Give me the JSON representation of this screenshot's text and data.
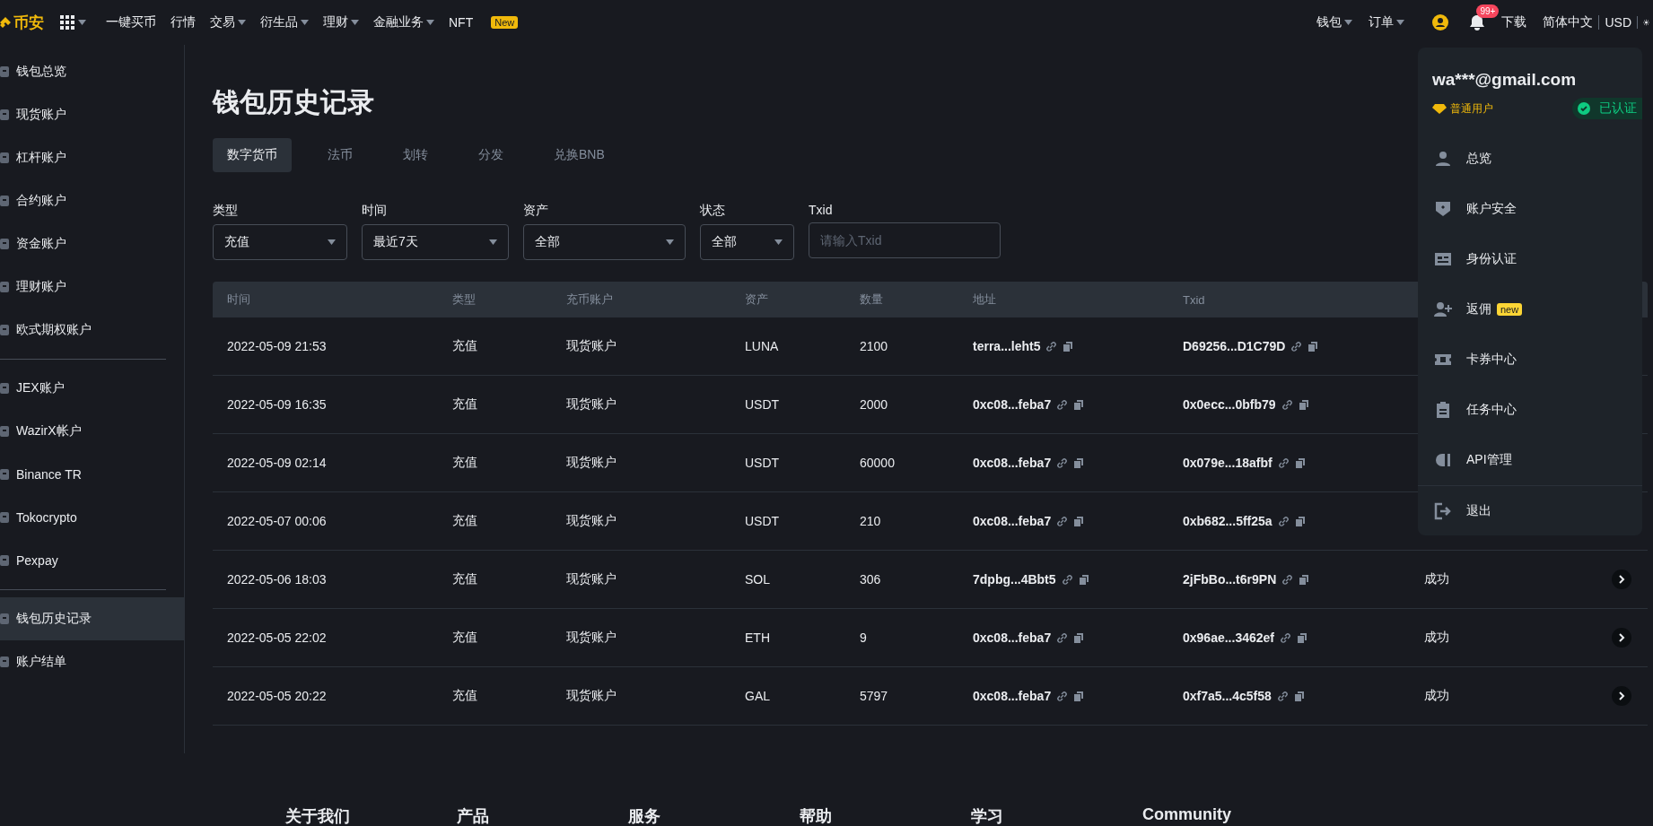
{
  "nav": {
    "logo": "币安",
    "items": [
      {
        "label": "一键买币",
        "dropdown": false
      },
      {
        "label": "行情",
        "dropdown": false
      },
      {
        "label": "交易",
        "dropdown": true
      },
      {
        "label": "衍生品",
        "dropdown": true
      },
      {
        "label": "理财",
        "dropdown": true
      },
      {
        "label": "金融业务",
        "dropdown": true
      },
      {
        "label": "NFT",
        "dropdown": false,
        "badge": "New"
      }
    ],
    "right": [
      {
        "kind": "menu",
        "label": "钱包"
      },
      {
        "kind": "menu",
        "label": "订单"
      },
      {
        "kind": "avatar"
      },
      {
        "kind": "bell",
        "badge": "99+"
      },
      {
        "kind": "link",
        "label": "下载",
        "separated": false
      },
      {
        "kind": "link",
        "label": "简体中文",
        "separated": false
      },
      {
        "kind": "link",
        "label": "USD",
        "separated": true
      },
      {
        "kind": "theme",
        "separated": true
      }
    ]
  },
  "sidebar": {
    "groups": [
      {
        "items": [
          {
            "label": "钱包总览",
            "selected": false
          },
          {
            "label": "现货账户",
            "selected": false
          },
          {
            "label": "杠杆账户",
            "selected": false
          },
          {
            "label": "合约账户",
            "selected": false
          },
          {
            "label": "资金账户",
            "selected": false
          },
          {
            "label": "理财账户",
            "selected": false
          },
          {
            "label": "欧式期权账户",
            "selected": false
          }
        ]
      },
      {
        "items": [
          {
            "label": "JEX账户",
            "selected": false
          },
          {
            "label": "WazirX帐户",
            "selected": false
          },
          {
            "label": "Binance TR",
            "selected": false
          },
          {
            "label": "Tokocrypto",
            "selected": false
          },
          {
            "label": "Pexpay",
            "selected": false
          }
        ]
      },
      {
        "items": [
          {
            "label": "钱包历史记录",
            "selected": true
          },
          {
            "label": "账户结单",
            "selected": false
          }
        ]
      }
    ]
  },
  "page": {
    "title": "钱包历史记录",
    "tabs": [
      {
        "label": "数字货币",
        "selected": true
      },
      {
        "label": "法币",
        "selected": false
      },
      {
        "label": "划转",
        "selected": false
      },
      {
        "label": "分发",
        "selected": false
      },
      {
        "label": "兑换BNB",
        "selected": false
      }
    ],
    "filters": [
      {
        "kind": "select",
        "label": "类型",
        "value": "充值"
      },
      {
        "kind": "select",
        "label": "时间",
        "value": "最近7天"
      },
      {
        "kind": "select",
        "label": "资产",
        "value": "全部"
      },
      {
        "kind": "select",
        "label": "状态",
        "value": "全部"
      },
      {
        "kind": "input",
        "label": "Txid",
        "placeholder": "请输入Txid"
      }
    ],
    "table": {
      "columns": [
        "时间",
        "类型",
        "充币账户",
        "资产",
        "数量",
        "地址",
        "Txid"
      ],
      "rows": [
        {
          "time": "2022-05-09 21:53",
          "type": "充值",
          "account": "现货账户",
          "asset": "LUNA",
          "amount": "2100",
          "address": "terra...leht5",
          "txid": "D69256...D1C79D"
        },
        {
          "time": "2022-05-09 16:35",
          "type": "充值",
          "account": "现货账户",
          "asset": "USDT",
          "amount": "2000",
          "address": "0xc08...feba7",
          "txid": "0x0ecc...0bfb79"
        },
        {
          "time": "2022-05-09 02:14",
          "type": "充值",
          "account": "现货账户",
          "asset": "USDT",
          "amount": "60000",
          "address": "0xc08...feba7",
          "txid": "0x079e...18afbf"
        },
        {
          "time": "2022-05-07 00:06",
          "type": "充值",
          "account": "现货账户",
          "asset": "USDT",
          "amount": "210",
          "address": "0xc08...feba7",
          "txid": "0xb682...5ff25a"
        },
        {
          "time": "2022-05-06 18:03",
          "type": "充值",
          "account": "现货账户",
          "asset": "SOL",
          "amount": "306",
          "address": "7dpbg...4Bbt5",
          "txid": "2jFbBo...t6r9PN",
          "status": "成功"
        },
        {
          "time": "2022-05-05 22:02",
          "type": "充值",
          "account": "现货账户",
          "asset": "ETH",
          "amount": "9",
          "address": "0xc08...feba7",
          "txid": "0x96ae...3462ef",
          "status": "成功"
        },
        {
          "time": "2022-05-05 20:22",
          "type": "充值",
          "account": "现货账户",
          "asset": "GAL",
          "amount": "5797",
          "address": "0xc08...feba7",
          "txid": "0xf7a5...4c5f58",
          "status": "成功"
        }
      ]
    }
  },
  "footer": {
    "headings": [
      "关于我们",
      "产品",
      "服务",
      "帮助",
      "学习",
      "Community"
    ]
  },
  "account_menu": {
    "email": "wa***@gmail.com",
    "level": "普通用户",
    "verified": "已认证",
    "items": [
      {
        "label": "总览",
        "separated": false
      },
      {
        "label": "账户安全",
        "separated": false
      },
      {
        "label": "身份认证",
        "separated": false
      },
      {
        "label": "返佣",
        "separated": false,
        "badge": "new"
      },
      {
        "label": "卡券中心",
        "separated": false
      },
      {
        "label": "任务中心",
        "separated": false
      },
      {
        "label": "API管理",
        "separated": false
      },
      {
        "label": "退出",
        "separated": true
      }
    ]
  }
}
